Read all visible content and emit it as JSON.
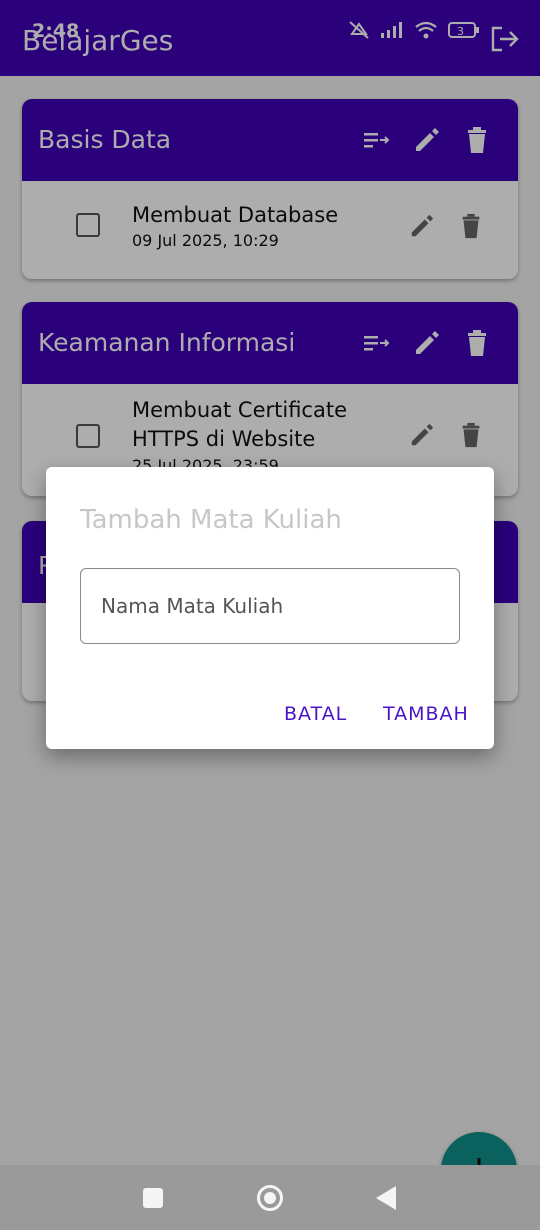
{
  "app": {
    "title": "BelajarGes"
  },
  "status_bar": {
    "time": "2:48",
    "battery": "3"
  },
  "courses": [
    {
      "title": "Basis Data",
      "tasks": [
        {
          "name": "Membuat Database",
          "date": "09 Jul 2025, 10:29"
        }
      ]
    },
    {
      "title": "Keamanan Informasi",
      "tasks": [
        {
          "name": "Membuat Certificate HTTPS di Website",
          "date": "25 Jul 2025, 23:59"
        }
      ]
    },
    {
      "title": "P",
      "tasks": []
    }
  ],
  "dialog": {
    "title": "Tambah Mata Kuliah",
    "input_placeholder": "Nama Mata Kuliah",
    "input_value": "",
    "cancel_label": "BATAL",
    "add_label": "TAMBAH"
  },
  "colors": {
    "primary": "#3f00b5",
    "accent_button": "#4b14c6",
    "fab": "#118f89"
  }
}
